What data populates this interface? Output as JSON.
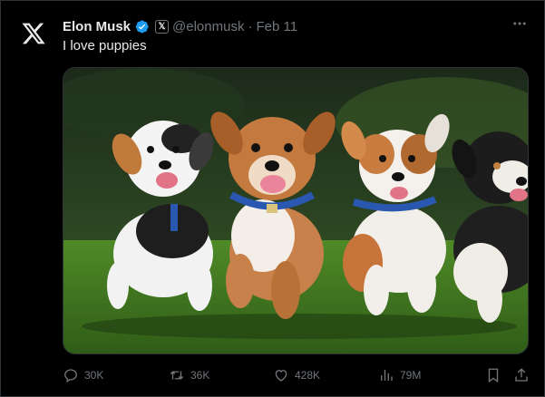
{
  "tweet": {
    "author_name": "Elon Musk",
    "affiliation_badge": "𝕏",
    "handle": "@elonmusk",
    "separator": "·",
    "date": "Feb 11",
    "text": "I love puppies"
  },
  "icons": {
    "avatar": "x-logo-icon",
    "verified": "verified-badge-icon",
    "more": "more-options-icon",
    "reply": "reply-icon",
    "retweet": "retweet-icon",
    "like": "heart-icon",
    "views": "views-chart-icon",
    "bookmark": "bookmark-icon",
    "share": "share-icon"
  },
  "metrics": {
    "replies": "30K",
    "retweets": "36K",
    "likes": "428K",
    "views": "79M"
  },
  "colors": {
    "background": "#000000",
    "text_primary": "#e7e9ea",
    "text_secondary": "#71767b",
    "verified_blue": "#1d9bf0",
    "border": "#2f3336"
  }
}
